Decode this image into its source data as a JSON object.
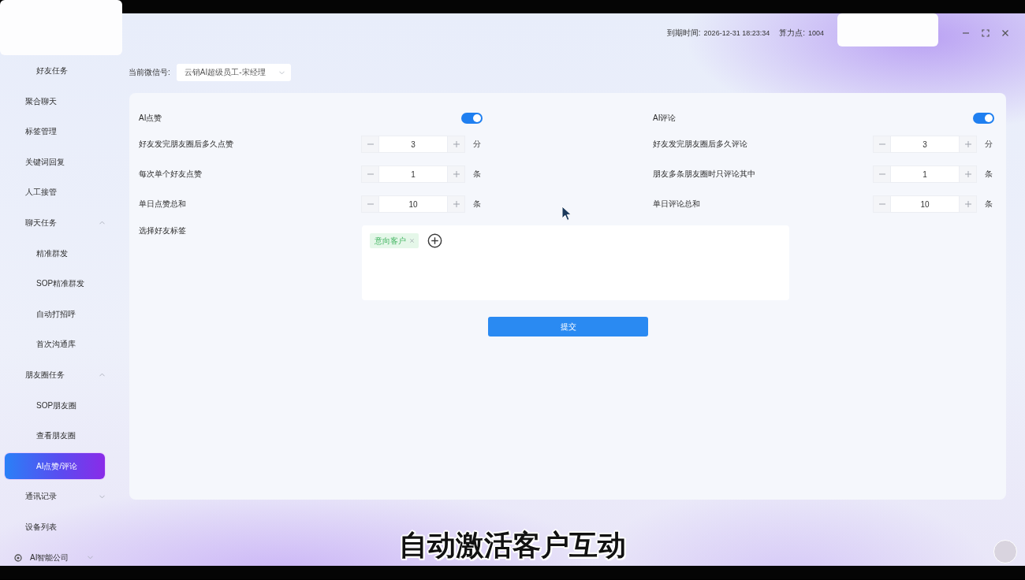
{
  "topbar": {
    "expiry_label": "到期时间:",
    "expiry_value": "2026-12-31 18:23:34",
    "points_label": "算力点:",
    "points_value": "1004"
  },
  "sidebar": {
    "items": [
      {
        "children": [
          {
            "label": "好友任务",
            "selected": false
          }
        ]
      },
      {
        "label": "聚合聊天",
        "selected": false
      },
      {
        "label": "标签管理",
        "selected": false
      },
      {
        "label": "关键词回复",
        "selected": false
      },
      {
        "label": "人工接管",
        "selected": false
      },
      {
        "label": "聊天任务",
        "selected": false,
        "expanded": true,
        "children": [
          {
            "label": "精准群发",
            "selected": false
          },
          {
            "label": "SOP精准群发",
            "selected": false
          },
          {
            "label": "自动打招呼",
            "selected": false
          },
          {
            "label": "首次沟通库",
            "selected": false
          }
        ]
      },
      {
        "label": "朋友圈任务",
        "selected": false,
        "expanded": true,
        "children": [
          {
            "label": "SOP朋友圈",
            "selected": false
          },
          {
            "label": "查看朋友圈",
            "selected": false
          },
          {
            "label": "AI点赞/评论",
            "selected": true
          }
        ]
      },
      {
        "label": "通讯记录",
        "selected": false,
        "expanded": false
      },
      {
        "label": "设备列表",
        "selected": false
      }
    ],
    "footer_item": {
      "label": "AI智能公司",
      "expanded": false
    }
  },
  "account": {
    "label": "当前微信号:",
    "value": "云销AI超级员工-宋经理"
  },
  "form": {
    "columns": [
      {
        "switch": {
          "label": "AI点赞",
          "on": true
        },
        "fields": [
          {
            "label": "好友发完朋友圈后多久点赞",
            "value": "3",
            "unit": "分"
          },
          {
            "label": "每次单个好友点赞",
            "value": "1",
            "unit": "条"
          },
          {
            "label": "单日点赞总和",
            "value": "10",
            "unit": "条"
          }
        ]
      },
      {
        "switch": {
          "label": "AI评论",
          "on": true
        },
        "fields": [
          {
            "label": "好友发完朋友圈后多久评论",
            "value": "3",
            "unit": "分"
          },
          {
            "label": "朋友多条朋友圈时只评论其中",
            "value": "1",
            "unit": "条"
          },
          {
            "label": "单日评论总和",
            "value": "10",
            "unit": "条"
          }
        ]
      }
    ],
    "tags": {
      "label": "选择好友标签",
      "items": [
        {
          "label": "意向客户"
        }
      ]
    },
    "submit": "提交"
  },
  "subtitle": "自动激活客户互动"
}
